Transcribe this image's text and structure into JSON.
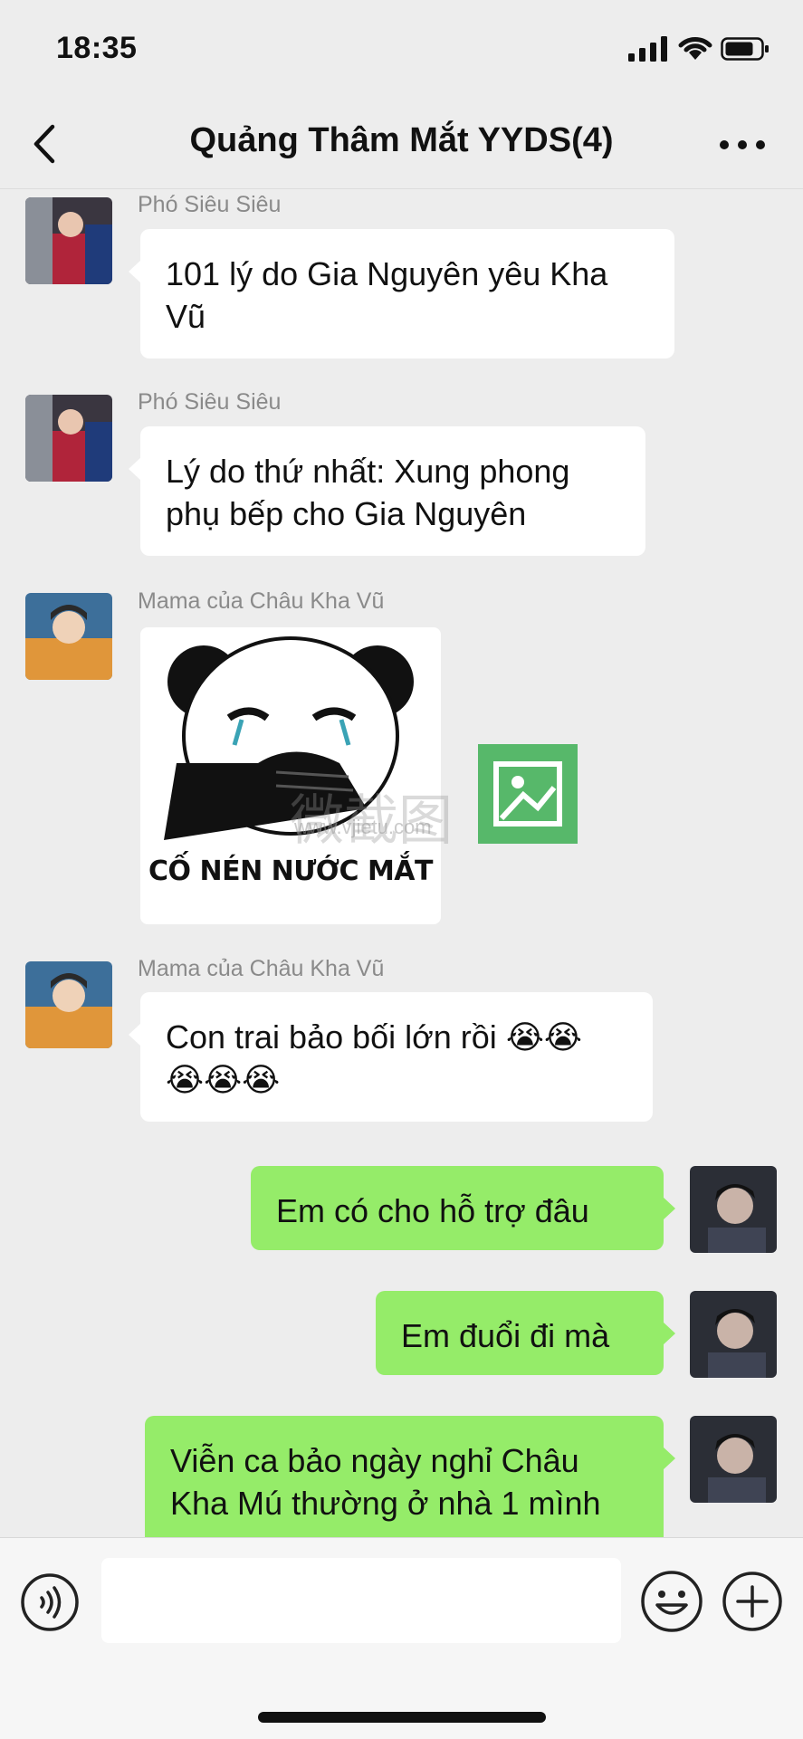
{
  "status_bar": {
    "time": "18:35"
  },
  "header": {
    "title": "Quảng Thâm Mắt YYDS(4)"
  },
  "messages": [
    {
      "sender": "Phó Siêu Siêu",
      "line1": "101 lý do Gia Nguyên yêu Kha",
      "line2": "Vũ"
    },
    {
      "sender": "Phó Siêu Siêu",
      "line1": "Lý do thứ nhất: Xung phong",
      "line2": "phụ bếp cho Gia Nguyên"
    },
    {
      "sender": "Mama của Châu Kha Vũ",
      "sticker_caption": "CỐ NÉN NƯỚC MẮT"
    },
    {
      "sender": "Mama của Châu Kha Vũ",
      "line1": "Con trai bảo bối lớn rồi",
      "line1_emoji": "😭😭",
      "line2_emoji": "😭😭😭"
    },
    {
      "text": "Em có cho hỗ trợ đâu"
    },
    {
      "text": "Em đuổi đi mà"
    },
    {
      "line1": "Viễn ca bảo ngày nghỉ Châu",
      "line2": "Kha Mú thường ở nhà 1 mình"
    }
  ],
  "watermark": {
    "text": "微截图",
    "url": "www.vjietu.com"
  },
  "icons": {
    "back": "chevron-left-icon",
    "more": "more-dots-icon",
    "voice": "voice-icon",
    "emoji": "emoji-icon",
    "plus": "plus-icon"
  },
  "colors": {
    "out_bubble": "#95ec69",
    "in_bubble": "#ffffff",
    "background": "#ededed"
  }
}
